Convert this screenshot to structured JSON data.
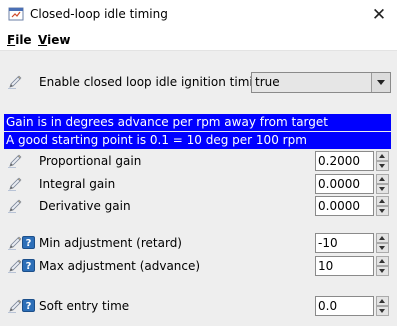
{
  "window": {
    "title": "Closed-loop idle timing",
    "close_glyph": "✕",
    "icon": "app-window-icon"
  },
  "menu": {
    "items": [
      {
        "label": "File",
        "mnemonic": "F",
        "rest": "ile"
      },
      {
        "label": "View",
        "mnemonic": "V",
        "rest": "iew"
      }
    ]
  },
  "enable": {
    "label": "Enable closed loop idle ignition timing",
    "value": "true"
  },
  "banners": [
    "Gain is in degrees advance per rpm away from target",
    "A good starting point is 0.1 = 10 deg per 100 rpm"
  ],
  "gains": [
    {
      "label": "Proportional gain",
      "value": "0.2000"
    },
    {
      "label": "Integral gain",
      "value": "0.0000"
    },
    {
      "label": "Derivative gain",
      "value": "0.0000"
    }
  ],
  "adjustments": [
    {
      "label": "Min adjustment (retard)",
      "value": "-10"
    },
    {
      "label": "Max adjustment (advance)",
      "value": "10"
    }
  ],
  "soft_entry": {
    "label": "Soft entry time",
    "value": "0.0"
  },
  "icons": {
    "edit": "pencil-icon",
    "help": "help-icon",
    "help_glyph": "?"
  },
  "colors": {
    "banner_bg": "#0000ff",
    "banner_fg": "#ffffff",
    "panel_bg": "#eeeeee"
  }
}
